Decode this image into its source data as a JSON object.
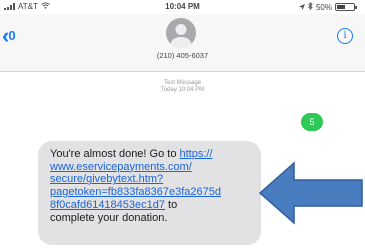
{
  "status": {
    "carrier": "AT&T",
    "time": "10:04 PM",
    "battery": "50%",
    "battery_level": 0.5
  },
  "header": {
    "back_count": "0",
    "contact_number": "(210) 405-6037",
    "info_label": "i"
  },
  "thread": {
    "timestamp_label": "Text Message",
    "timestamp_time": "Today 10:04 PM",
    "sent_message": "5",
    "received": {
      "prefix": "You're almost done! Go to ",
      "link_lines": [
        "https://",
        "www.eservicepayments.com/",
        "secure/givebytext.htm?",
        "pagetoken=fb833fa8367e3fa2675d",
        "8f0cafd61418453ec1d7"
      ],
      "after_link": " to",
      "suffix": "complete your donation."
    }
  },
  "colors": {
    "ios_blue": "#1a7cf5",
    "sent_green": "#2ec957",
    "received_gray": "#e2e2e4",
    "arrow_blue": "#4a7cc0"
  }
}
